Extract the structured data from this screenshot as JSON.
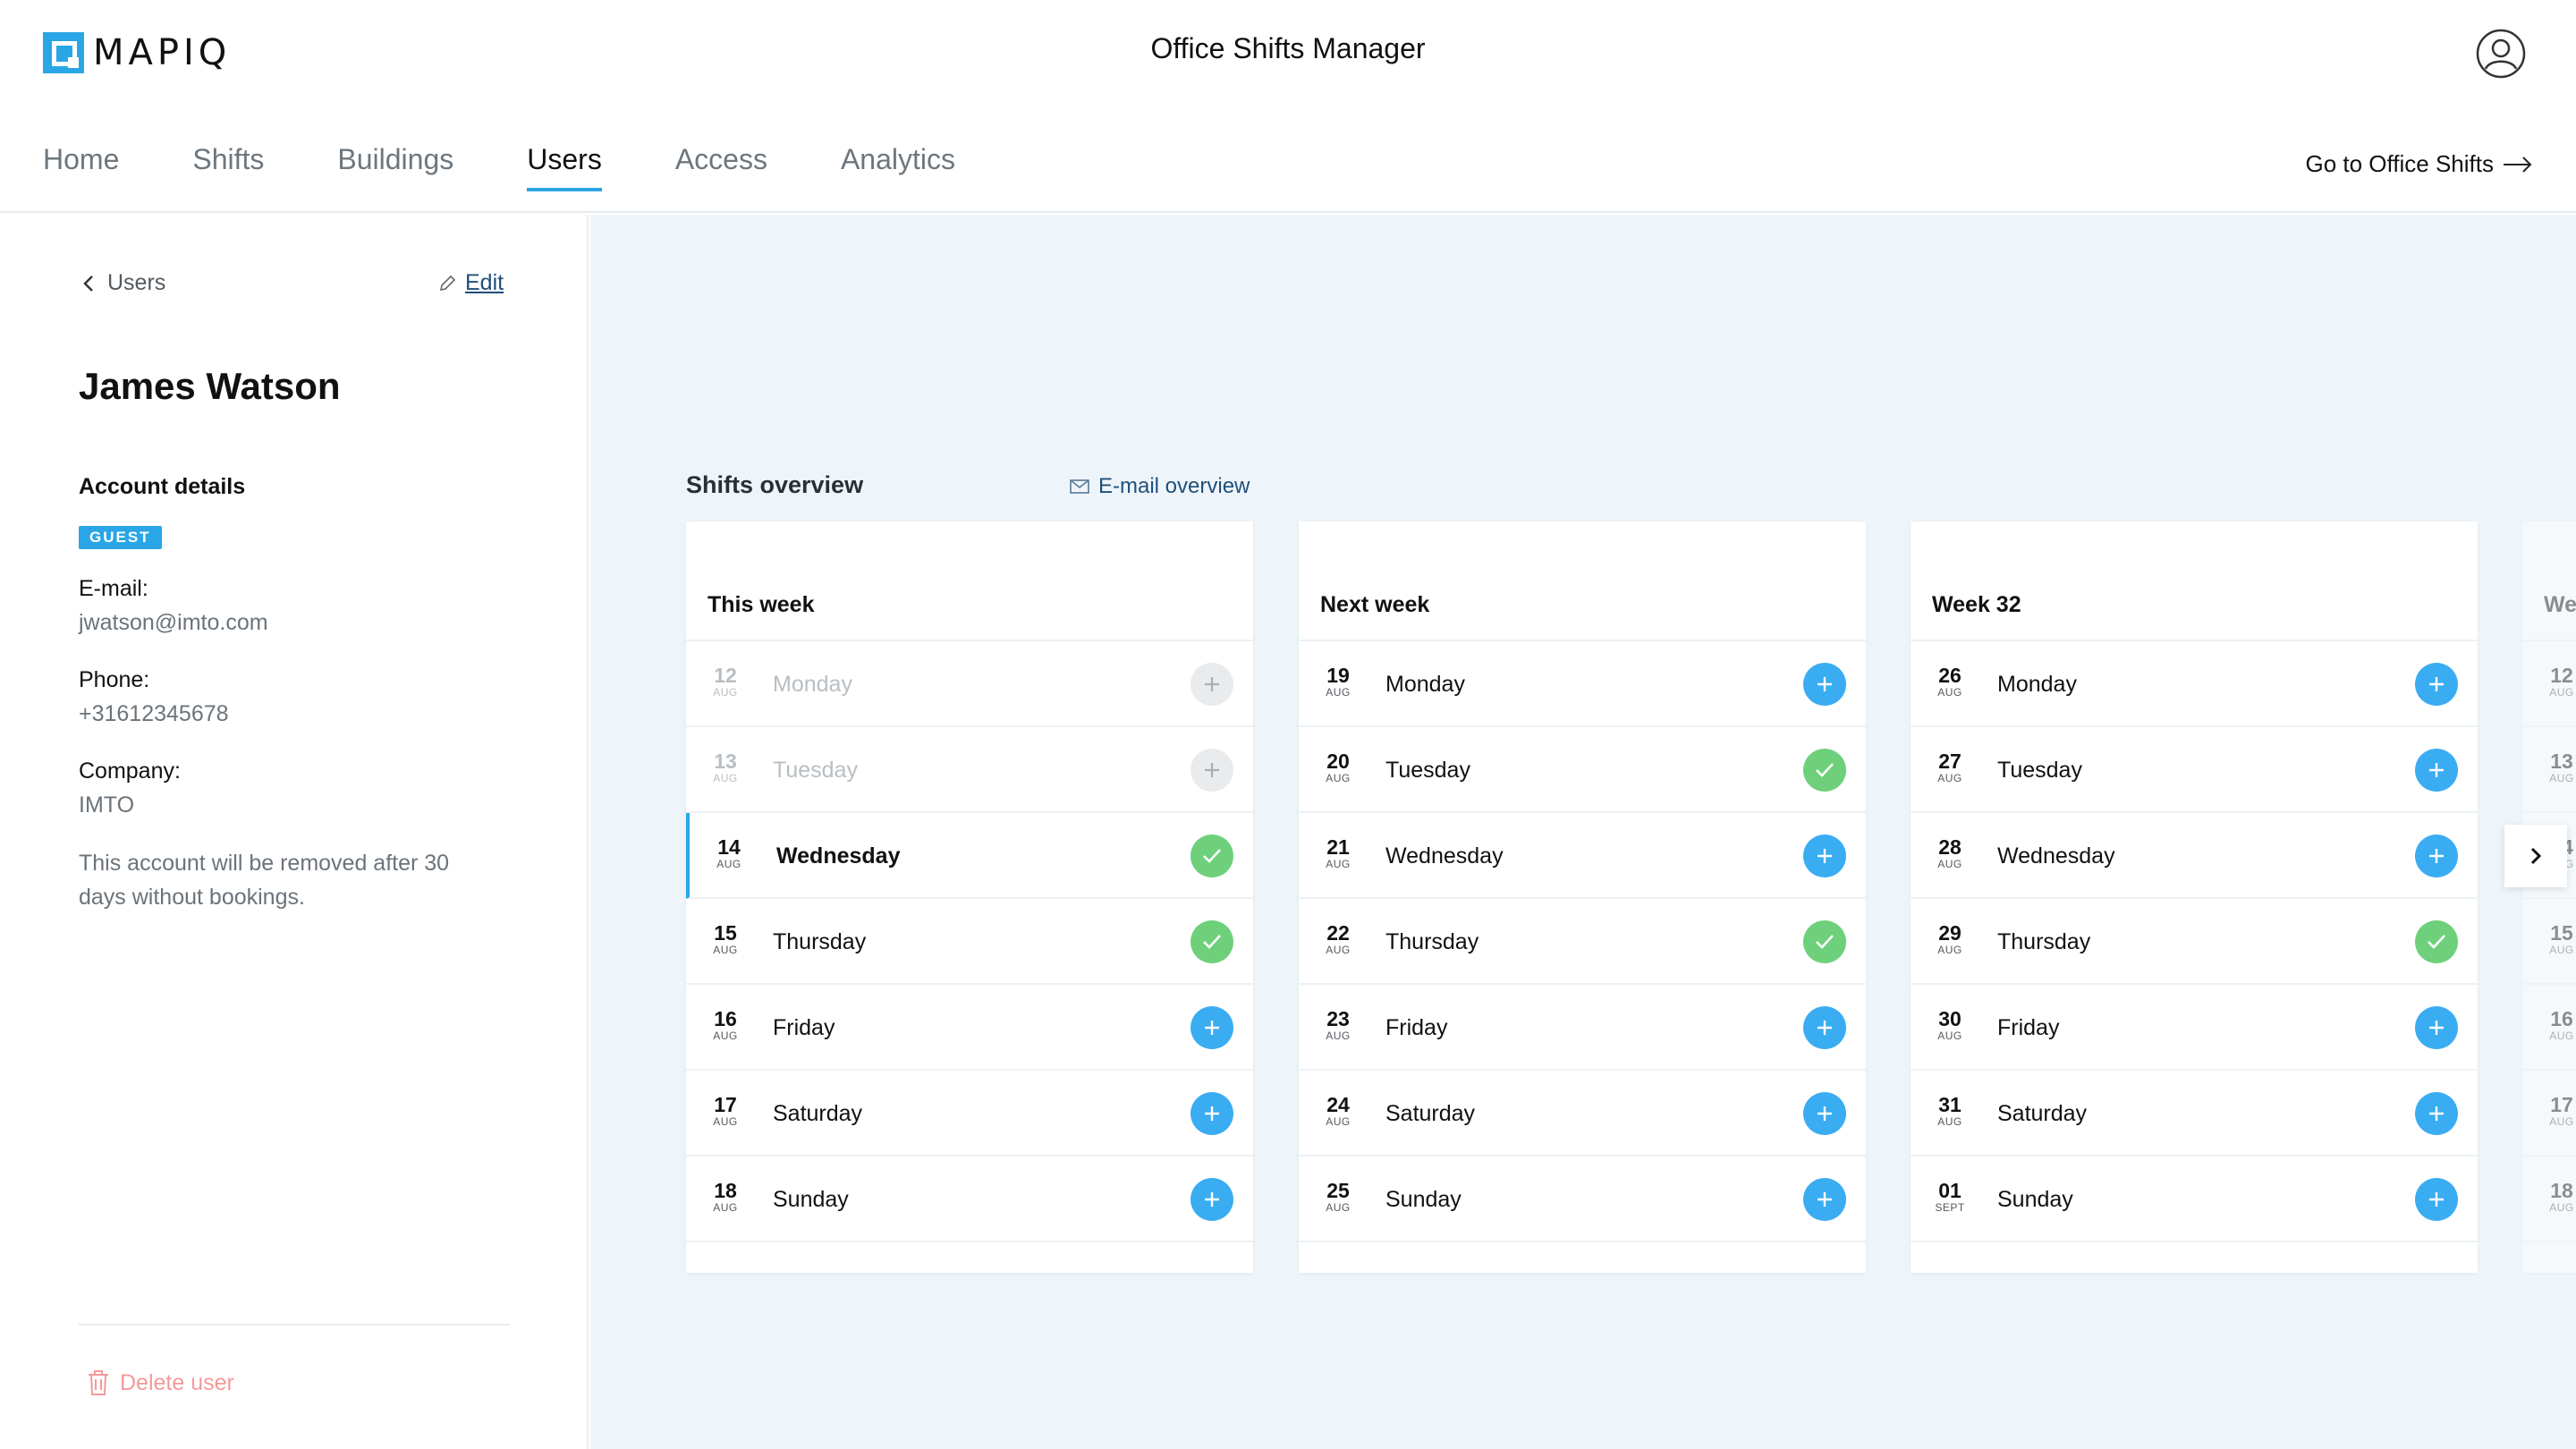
{
  "brand": {
    "name": "MAPIQ",
    "accent": "#2aa6e6"
  },
  "header": {
    "title": "Office Shifts Manager",
    "goto_label": "Go to Office Shifts"
  },
  "nav": {
    "items": [
      {
        "label": "Home",
        "active": false
      },
      {
        "label": "Shifts",
        "active": false
      },
      {
        "label": "Buildings",
        "active": false
      },
      {
        "label": "Users",
        "active": true
      },
      {
        "label": "Access",
        "active": false
      },
      {
        "label": "Analytics",
        "active": false
      }
    ]
  },
  "sidebar": {
    "back_label": "Users",
    "edit_label": "Edit",
    "user_name": "James Watson",
    "account_title": "Account details",
    "badge": "GUEST",
    "email_label": "E-mail:",
    "email_value": "jwatson@imto.com",
    "phone_label": "Phone:",
    "phone_value": "+31612345678",
    "company_label": "Company:",
    "company_value": "IMTO",
    "note": "This account will be removed after 30 days without bookings.",
    "delete_label": "Delete user"
  },
  "overview": {
    "title": "Shifts overview",
    "email_label": "E-mail overview",
    "weeks": [
      {
        "label": "This week",
        "days": [
          {
            "date": "12",
            "month": "AUG",
            "day": "Monday",
            "status": "disabled",
            "past": true
          },
          {
            "date": "13",
            "month": "AUG",
            "day": "Tuesday",
            "status": "disabled",
            "past": true
          },
          {
            "date": "14",
            "month": "AUG",
            "day": "Wednesday",
            "status": "booked",
            "today": true
          },
          {
            "date": "15",
            "month": "AUG",
            "day": "Thursday",
            "status": "booked"
          },
          {
            "date": "16",
            "month": "AUG",
            "day": "Friday",
            "status": "add"
          },
          {
            "date": "17",
            "month": "AUG",
            "day": "Saturday",
            "status": "add"
          },
          {
            "date": "18",
            "month": "AUG",
            "day": "Sunday",
            "status": "add"
          }
        ]
      },
      {
        "label": "Next week",
        "days": [
          {
            "date": "19",
            "month": "AUG",
            "day": "Monday",
            "status": "add"
          },
          {
            "date": "20",
            "month": "AUG",
            "day": "Tuesday",
            "status": "booked"
          },
          {
            "date": "21",
            "month": "AUG",
            "day": "Wednesday",
            "status": "add"
          },
          {
            "date": "22",
            "month": "AUG",
            "day": "Thursday",
            "status": "booked"
          },
          {
            "date": "23",
            "month": "AUG",
            "day": "Friday",
            "status": "add"
          },
          {
            "date": "24",
            "month": "AUG",
            "day": "Saturday",
            "status": "add"
          },
          {
            "date": "25",
            "month": "AUG",
            "day": "Sunday",
            "status": "add"
          }
        ]
      },
      {
        "label": "Week 32",
        "days": [
          {
            "date": "26",
            "month": "AUG",
            "day": "Monday",
            "status": "add"
          },
          {
            "date": "27",
            "month": "AUG",
            "day": "Tuesday",
            "status": "add"
          },
          {
            "date": "28",
            "month": "AUG",
            "day": "Wednesday",
            "status": "add"
          },
          {
            "date": "29",
            "month": "AUG",
            "day": "Thursday",
            "status": "booked"
          },
          {
            "date": "30",
            "month": "AUG",
            "day": "Friday",
            "status": "add"
          },
          {
            "date": "31",
            "month": "AUG",
            "day": "Saturday",
            "status": "add"
          },
          {
            "date": "01",
            "month": "SEPT",
            "day": "Sunday",
            "status": "add"
          }
        ]
      },
      {
        "label": "We",
        "partial": true,
        "days": [
          {
            "date": "12",
            "month": "AUG",
            "day": "",
            "status": "none"
          },
          {
            "date": "13",
            "month": "AUG",
            "day": "",
            "status": "none"
          },
          {
            "date": "14",
            "month": "AUG",
            "day": "",
            "status": "none"
          },
          {
            "date": "15",
            "month": "AUG",
            "day": "",
            "status": "none"
          },
          {
            "date": "16",
            "month": "AUG",
            "day": "",
            "status": "none"
          },
          {
            "date": "17",
            "month": "AUG",
            "day": "",
            "status": "none"
          },
          {
            "date": "18",
            "month": "AUG",
            "day": "",
            "status": "none"
          }
        ]
      }
    ]
  },
  "colors": {
    "add": "#3aacf2",
    "booked": "#6ed07a",
    "disabled": "#e9ebed",
    "background": "#eef5fa"
  }
}
